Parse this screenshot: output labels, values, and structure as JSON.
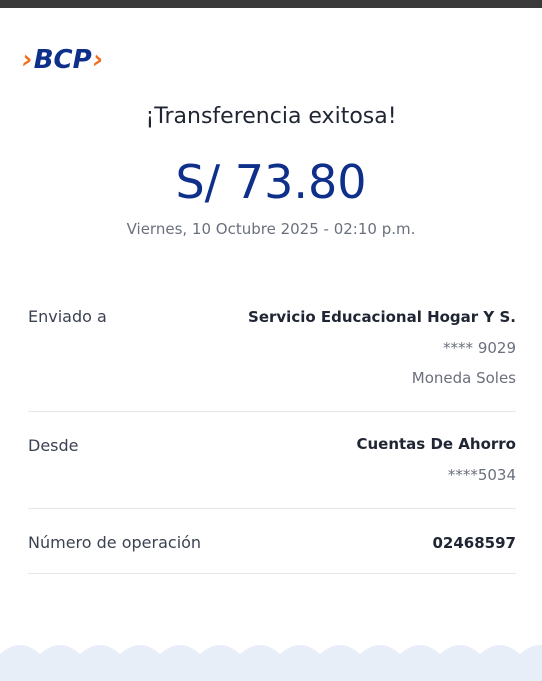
{
  "brand": {
    "name": "BCP"
  },
  "receipt": {
    "title": "¡Transferencia exitosa!",
    "amount": "S/ 73.80",
    "datetime": "Viernes, 10 Octubre 2025 - 02:10 p.m."
  },
  "details": {
    "sent_to": {
      "label": "Enviado a",
      "name": "Servicio Educacional Hogar Y S.",
      "account": "**** 9029",
      "currency": "Moneda Soles"
    },
    "from": {
      "label": "Desde",
      "account_type": "Cuentas De Ahorro",
      "account": "****5034"
    },
    "operation": {
      "label": "Número de operación",
      "number": "02468597"
    }
  },
  "colors": {
    "brand_blue": "#0e2f8a",
    "brand_orange": "#f26f21",
    "footer_blue": "#e7eef8"
  }
}
